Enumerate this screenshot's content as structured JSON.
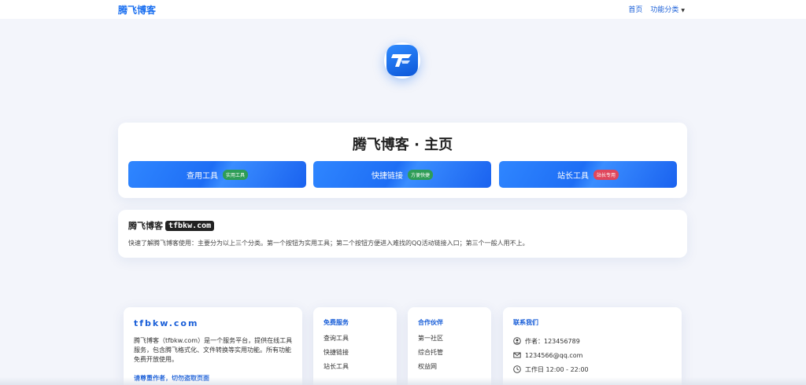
{
  "navbar": {
    "brand": "腾飞博客",
    "links": [
      "首页",
      "功能分类"
    ]
  },
  "hero": {
    "title": "腾飞博客 · 主页",
    "buttons": [
      {
        "label": "查用工具",
        "badge": "实用工具",
        "badge_color": "#2e9d57"
      },
      {
        "label": "快捷链接",
        "badge": "方便快捷",
        "badge_color": "#2e9d57"
      },
      {
        "label": "站长工具",
        "badge": "站长专用",
        "badge_color": "#e0475c"
      }
    ]
  },
  "info": {
    "title": "腾飞博客",
    "domain": "tfbkw.com",
    "description": "快速了解腾飞博客使用：主要分为以上三个分类。第一个按钮为实用工具；第二个按钮方便进入难找的QQ活动链接入口；第三个一般人用不上。"
  },
  "footer": {
    "site": {
      "title": "tfbkw.com",
      "description": "腾飞博客（tfbkw.com）是一个服务平台，提供在线工具服务，包含腾飞格式化、文件转换等实用功能。所有功能免费开放使用。",
      "warning": "请尊重作者，切勿盗取页面"
    },
    "services": {
      "heading": "免费服务",
      "items": [
        "查询工具",
        "快捷链接",
        "站长工具"
      ]
    },
    "partners": {
      "heading": "合作伙伴",
      "items": [
        "第一社区",
        "综合托管",
        "权益网"
      ]
    },
    "contact": {
      "heading": "联系我们",
      "author": "作者：123456789",
      "email": "1234566@qq.com",
      "hours": "工作日 12:00 - 22:00"
    }
  },
  "colors": {
    "accent": "#1a6ff0"
  }
}
